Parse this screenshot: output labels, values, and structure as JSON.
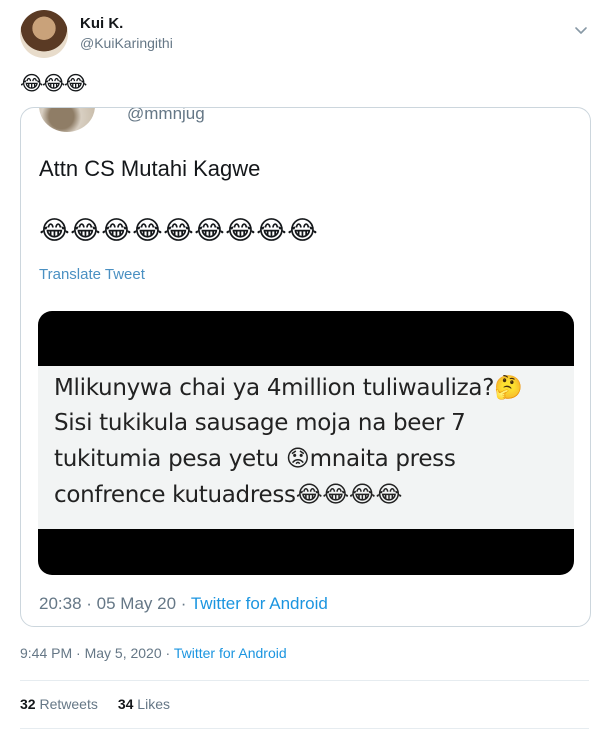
{
  "author": {
    "name": "Kui K.",
    "handle": "@KuiKaringithi"
  },
  "tweet": {
    "emojis": [
      "😂",
      "😂",
      "😂"
    ],
    "timestamp": "9:44 PM · May 5, 2020 · ",
    "source": "Twitter for Android"
  },
  "quoted": {
    "handle": "@mmnjug",
    "text": "Attn CS Mutahi Kagwe",
    "emojis": [
      "😂",
      "😂",
      "😂",
      "😂",
      "😂",
      "😂",
      "😂",
      "😂",
      "😂"
    ],
    "translate_label": "Translate Tweet",
    "media_lines": [
      "Mlikunywa chai ya 4million tuliwauliza?🤔",
      "Sisi tukikula sausage moja na beer 7",
      "tukitumia pesa yetu 😟mnaita press",
      "confrence kutuadress😂😂😂😂"
    ],
    "meta_time": "20:38 · 05 May 20 · ",
    "meta_source": "Twitter for Android"
  },
  "stats": {
    "retweets_count": "32",
    "retweets_label": "Retweets",
    "likes_count": "34",
    "likes_label": "Likes"
  },
  "icons": {
    "more": "chevron-down-icon"
  },
  "colors": {
    "link": "#1b95e0",
    "muted": "#657786",
    "border": "#ccd6dd"
  }
}
